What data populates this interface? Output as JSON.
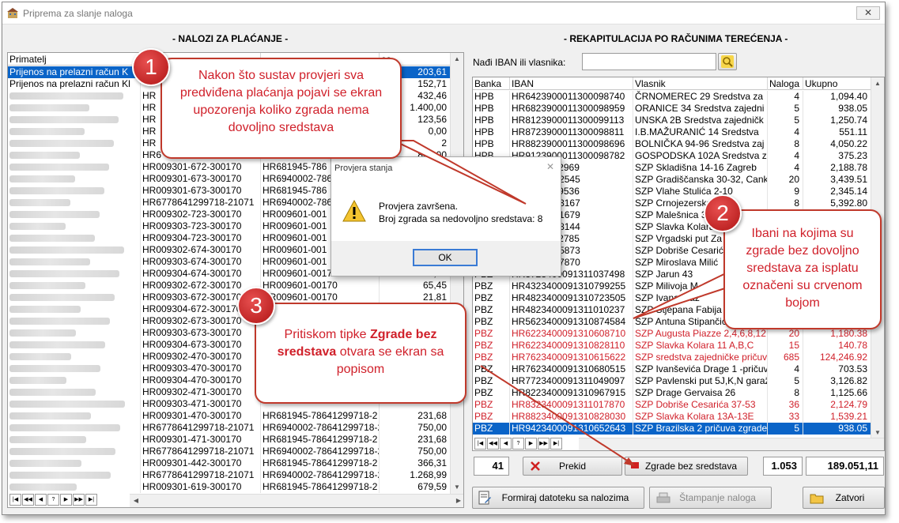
{
  "window": {
    "title": "Priprema za slanje naloga",
    "close_label": "✕"
  },
  "left": {
    "section_title": "- NALOZI ZA PLAĆANJE -",
    "columns": [
      "Primatelj",
      "",
      "",
      "os"
    ],
    "rows": [
      {
        "primatelj": "Prijenos na prelazni račun K",
        "acc": "",
        "iban": "",
        "iznos": "203,61",
        "blur": false,
        "selected": true
      },
      {
        "primatelj": "Prijenos na prelazni račun Kl",
        "acc": "",
        "iban": "",
        "iznos": "152,71",
        "blur": false
      },
      {
        "primatelj": "",
        "acc": "HR",
        "iban": "",
        "iznos": "432,46",
        "blur": true
      },
      {
        "primatelj": "",
        "acc": "HR",
        "iban": "",
        "iznos": "1.400,00",
        "blur": true
      },
      {
        "primatelj": "",
        "acc": "HR",
        "iban": "",
        "iznos": "123,56",
        "blur": true
      },
      {
        "primatelj": "",
        "acc": "HR",
        "iban": "",
        "iznos": "0,00",
        "blur": true
      },
      {
        "primatelj": "",
        "acc": "HR",
        "iban": "",
        "iznos": "2",
        "blur": true
      },
      {
        "primatelj": "",
        "acc": "HR6",
        "iban": "",
        "iznos": "800,00",
        "blur": true
      },
      {
        "primatelj": "",
        "acc": "HR009301-672-300170",
        "iban": "HR681945-786",
        "iznos": "",
        "blur": true
      },
      {
        "primatelj": "",
        "acc": "HR009301-673-300170",
        "iban": "HR6940002-786",
        "iznos": "",
        "blur": true
      },
      {
        "primatelj": "",
        "acc": "HR009301-673-300170",
        "iban": "HR681945-786",
        "iznos": "",
        "blur": true
      },
      {
        "primatelj": "",
        "acc": "HR6778641299718-21071",
        "iban": "HR6940002-786",
        "iznos": "",
        "blur": true
      },
      {
        "primatelj": "",
        "acc": "HR009302-723-300170",
        "iban": "HR009601-001",
        "iznos": "",
        "blur": true
      },
      {
        "primatelj": "",
        "acc": "HR009303-723-300170",
        "iban": "HR009601-001",
        "iznos": "",
        "blur": true
      },
      {
        "primatelj": "",
        "acc": "HR009304-723-300170",
        "iban": "HR009601-001",
        "iznos": "",
        "blur": true
      },
      {
        "primatelj": "",
        "acc": "HR009302-674-300170",
        "iban": "HR009601-001",
        "iznos": "",
        "blur": true
      },
      {
        "primatelj": "",
        "acc": "HR009303-674-300170",
        "iban": "HR009601-001",
        "iznos": "",
        "blur": true
      },
      {
        "primatelj": "",
        "acc": "HR009304-674-300170",
        "iban": "HR009601-00170",
        "iznos": "57,20",
        "blur": true
      },
      {
        "primatelj": "",
        "acc": "HR009302-672-300170",
        "iban": "HR009601-00170",
        "iznos": "65,45",
        "blur": true
      },
      {
        "primatelj": "",
        "acc": "HR009303-672-300170",
        "iban": "HR009601-00170",
        "iznos": "21,81",
        "blur": true
      },
      {
        "primatelj": "",
        "acc": "HR009304-672-300170",
        "iban": "",
        "iznos": "",
        "blur": true
      },
      {
        "primatelj": "",
        "acc": "HR009302-673-300170",
        "iban": "",
        "iznos": "",
        "blur": true
      },
      {
        "primatelj": "",
        "acc": "HR009303-673-300170",
        "iban": "",
        "iznos": "",
        "blur": true
      },
      {
        "primatelj": "",
        "acc": "HR009304-673-300170",
        "iban": "",
        "iznos": "",
        "blur": true
      },
      {
        "primatelj": "",
        "acc": "HR009302-470-300170",
        "iban": "",
        "iznos": "",
        "blur": true
      },
      {
        "primatelj": "",
        "acc": "HR009303-470-300170",
        "iban": "",
        "iznos": "",
        "blur": true
      },
      {
        "primatelj": "",
        "acc": "HR009304-470-300170",
        "iban": "",
        "iznos": "",
        "blur": true
      },
      {
        "primatelj": "",
        "acc": "HR009302-471-300170",
        "iban": "",
        "iznos": "",
        "blur": true
      },
      {
        "primatelj": "",
        "acc": "HR009303-471-300170",
        "iban": "",
        "iznos": "",
        "blur": true
      },
      {
        "primatelj": "",
        "acc": "HR009301-470-300170",
        "iban": "HR681945-78641299718-2",
        "iznos": "231,68",
        "blur": true
      },
      {
        "primatelj": "",
        "acc": "HR6778641299718-21071",
        "iban": "HR6940002-78641299718-2",
        "iznos": "750,00",
        "blur": true
      },
      {
        "primatelj": "",
        "acc": "HR009301-471-300170",
        "iban": "HR681945-78641299718-2",
        "iznos": "231,68",
        "blur": true
      },
      {
        "primatelj": "",
        "acc": "HR6778641299718-21071",
        "iban": "HR6940002-78641299718-2",
        "iznos": "750,00",
        "blur": true
      },
      {
        "primatelj": "",
        "acc": "HR009301-442-300170",
        "iban": "HR681945-78641299718-2",
        "iznos": "366,31",
        "blur": true
      },
      {
        "primatelj": "",
        "acc": "HR6778641299718-21071",
        "iban": "HR6940002-78641299718-2",
        "iznos": "1.268,99",
        "blur": true
      },
      {
        "primatelj": "",
        "acc": "HR009301-619-300170",
        "iban": "HR681945-78641299718-2",
        "iznos": "679,59",
        "blur": true
      }
    ]
  },
  "right": {
    "section_title": "- REKAPITULACIJA PO RAČUNIMA TEREĆENJA -",
    "search_label": "Nađi IBAN ili vlasnika:",
    "search_value": "",
    "columns": [
      "Banka",
      "IBAN",
      "Vlasnik",
      "Naloga",
      "Ukupno"
    ],
    "rows": [
      {
        "banka": "HPB",
        "iban": "HR6423900011300098740",
        "vlasnik": "ČRNOMEREC 29  Sredstva za",
        "naloga": "4",
        "ukupno": "1,094.40"
      },
      {
        "banka": "HPB",
        "iban": "HR6823900011300098959",
        "vlasnik": "ORANICE 34  Sredstva zajedni",
        "naloga": "5",
        "ukupno": "938.05"
      },
      {
        "banka": "HPB",
        "iban": "HR8123900011300099113",
        "vlasnik": "UNSKA 2B  Sredstva zajedničk",
        "naloga": "5",
        "ukupno": "1,250.74"
      },
      {
        "banka": "HPB",
        "iban": "HR8723900011300098811",
        "vlasnik": "I.B.MAŽURANIĆ 14  Sredstva",
        "naloga": "4",
        "ukupno": "551.11"
      },
      {
        "banka": "HPB",
        "iban": "HR8823900011300098696",
        "vlasnik": "BOLNIČKA 94-96  Sredstva zaj",
        "naloga": "8",
        "ukupno": "4,050.22"
      },
      {
        "banka": "HPB",
        "iban": "HR9123900011300098782",
        "vlasnik": "GOSPODSKA 102A  Sredstva za",
        "naloga": "4",
        "ukupno": "375.23"
      },
      {
        "banka": "",
        "iban": "0091311032969",
        "vlasnik": "SZP Skladišna 14-16 Zagreb",
        "naloga": "4",
        "ukupno": "2,188.78"
      },
      {
        "banka": "",
        "iban": "0091310972545",
        "vlasnik": "SZP Gradiščanska 30-32, Cank",
        "naloga": "20",
        "ukupno": "3,439.51"
      },
      {
        "banka": "",
        "iban": "0091311039536",
        "vlasnik": "SZP Vlahe Stulića 2-10",
        "naloga": "9",
        "ukupno": "2,345.14"
      },
      {
        "banka": "",
        "iban": "0091310653167",
        "vlasnik": "SZP Crnojezerska",
        "naloga": "8",
        "ukupno": "5,392.80"
      },
      {
        "banka": "",
        "iban": "0091310951679",
        "vlasnik": "SZP Malešnica 3",
        "naloga": "",
        "ukupno": ""
      },
      {
        "banka": "",
        "iban": "0091310828144",
        "vlasnik": "SZP Slavka Kolara",
        "naloga": "",
        "ukupno": ""
      },
      {
        "banka": "",
        "iban": "0091311012785",
        "vlasnik": "SZP Vrgadski put Za",
        "naloga": "",
        "ukupno": ""
      },
      {
        "banka": "",
        "iban": "0091310745873",
        "vlasnik": "SZP Dobriše Cesarić",
        "naloga": "",
        "ukupno": ""
      },
      {
        "banka": "",
        "iban": "0091310967870",
        "vlasnik": "SZP Miroslava Milić",
        "naloga": "",
        "ukupno": ""
      },
      {
        "banka": "PBZ",
        "iban": "HR3723400091311037498",
        "vlasnik": "SZP Jarun 43",
        "naloga": "",
        "ukupno": ""
      },
      {
        "banka": "PBZ",
        "iban": "HR4323400091310799255",
        "vlasnik": "SZP Milivoja M",
        "naloga": "",
        "ukupno": ""
      },
      {
        "banka": "PBZ",
        "iban": "HR4823400091310723505",
        "vlasnik": "SZP Ivana Maž",
        "naloga": "",
        "ukupno": ""
      },
      {
        "banka": "PBZ",
        "iban": "HR4823400091311010237",
        "vlasnik": "SZP Stjepana Fabija",
        "naloga": "",
        "ukupno": ""
      },
      {
        "banka": "PBZ",
        "iban": "HR5623400091310874584",
        "vlasnik": "SZP Antuna Stipančića",
        "naloga": "",
        "ukupno": ""
      },
      {
        "banka": "PBZ",
        "iban": "HR6223400091310608710",
        "vlasnik": "SZP Augusta Piazze 2,4,6,8,12",
        "naloga": "20",
        "ukupno": "1,180.38",
        "red": true
      },
      {
        "banka": "PBZ",
        "iban": "HR6223400091310828110",
        "vlasnik": "SZP Slavka Kolara 11 A,B,C",
        "naloga": "15",
        "ukupno": "140.78",
        "red": true
      },
      {
        "banka": "PBZ",
        "iban": "HR7623400091310615622",
        "vlasnik": "SZP sredstva zajedničke pričuv",
        "naloga": "685",
        "ukupno": "124,246.92",
        "red": true
      },
      {
        "banka": "PBZ",
        "iban": "HR7623400091310680515",
        "vlasnik": "SZP Ivanševića Drage 1 -pričuv",
        "naloga": "4",
        "ukupno": "703.53"
      },
      {
        "banka": "PBZ",
        "iban": "HR7723400091311049097",
        "vlasnik": "SZP Pavlenski put 5J,K,N garaž",
        "naloga": "5",
        "ukupno": "3,126.82"
      },
      {
        "banka": "PBZ",
        "iban": "HR8223400091310967915",
        "vlasnik": "SZP Drage Gervaisa 26",
        "naloga": "8",
        "ukupno": "1,125.66"
      },
      {
        "banka": "PBZ",
        "iban": "HR8323400091311017870",
        "vlasnik": "SZP Dobriše Cesarića 37-53",
        "naloga": "36",
        "ukupno": "2,124.79",
        "red": true
      },
      {
        "banka": "PBZ",
        "iban": "HR8823400091310828030",
        "vlasnik": "SZP Slavka Kolara 13A-13E",
        "naloga": "33",
        "ukupno": "1,539.21",
        "red": true
      },
      {
        "banka": "PBZ",
        "iban": "HR9423400091310652643",
        "vlasnik": "SZP Brazilska 2 pričuva zgrade",
        "naloga": "5",
        "ukupno": "938.05",
        "selected": true
      }
    ],
    "count_box": "41",
    "naloga_total": "1.053",
    "ukupno_total": "189.051,11"
  },
  "buttons": {
    "prekid": "Prekid",
    "zgrade_bez_sredstava": "Zgrade bez sredstava",
    "formiraj": "Formiraj datoteku sa nalozima",
    "stampanje": "Štampanje naloga",
    "zatvori": "Zatvori"
  },
  "dialog": {
    "title": "Provjera stanja",
    "line1": "Provjera završena.",
    "line2": "Broj zgrada sa nedovoljno sredstava: 8",
    "ok_label": "OK"
  },
  "callouts": [
    {
      "number": "1",
      "text": "Nakon što sustav provjeri sva predviđena plaćanja pojavi se ekran upozorenja koliko zgrada nema dovoljno sredstava"
    },
    {
      "number": "2",
      "text": "Ibani na kojima su zgrade bez dovoljno sredstava za isplatu označeni su crvenom bojom"
    },
    {
      "number": "3",
      "text_before": "Pritiskom tipke ",
      "text_bold": "Zgrade bez sredstava",
      "text_after": " otvara se ekran sa popisom"
    }
  ],
  "nav_buttons": [
    "|◀",
    "◀◀",
    "◀",
    "?",
    "▶",
    "▶▶",
    "▶|"
  ],
  "colors": {
    "selection": "#0a64c8",
    "warning_red": "#d0202a",
    "callout_border": "#c0392b"
  }
}
